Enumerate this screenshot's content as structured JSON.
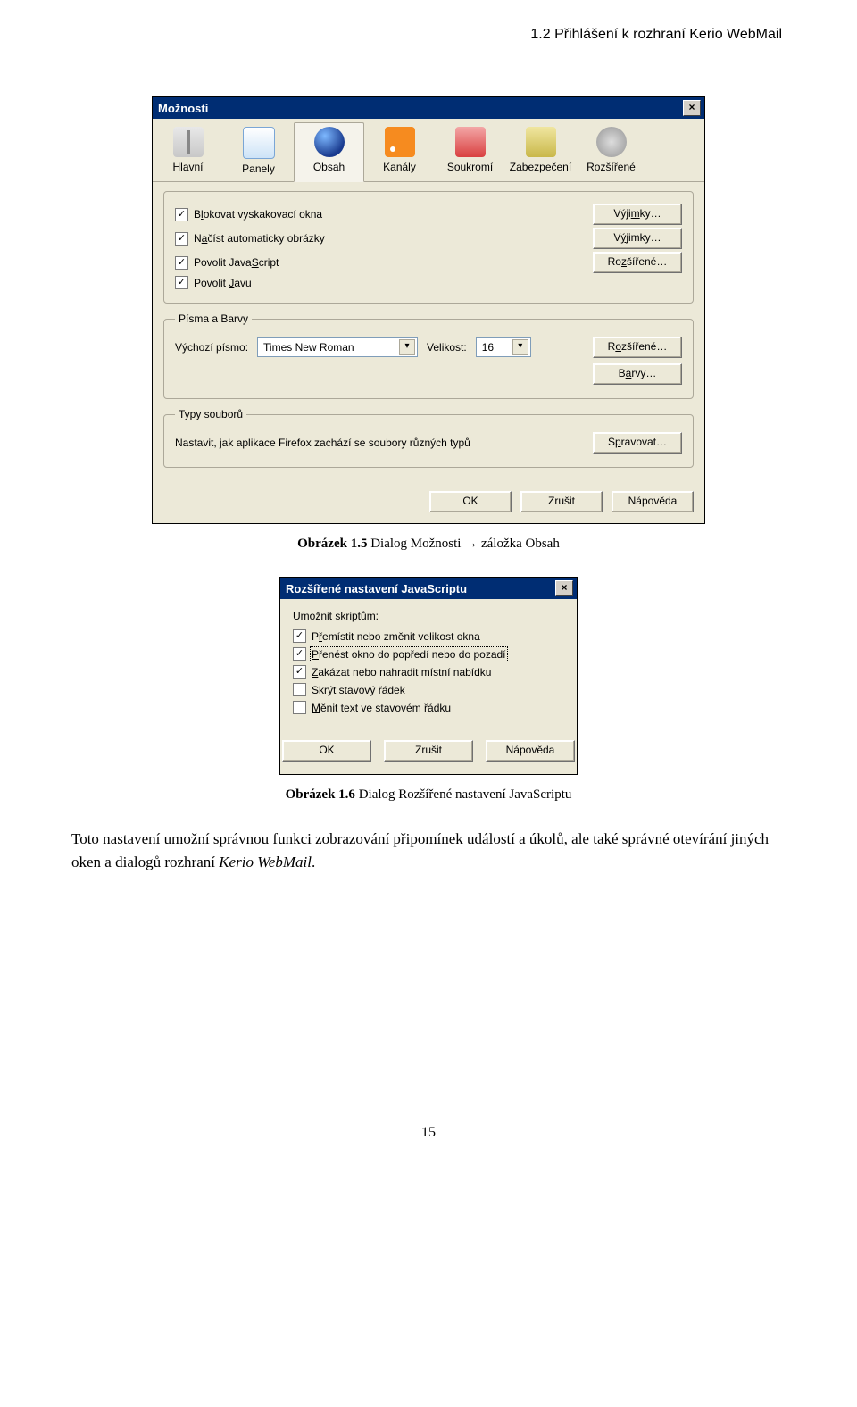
{
  "header": "1.2  Přihlášení k rozhraní Kerio WebMail",
  "dialog1": {
    "title": "Možnosti",
    "close": "×",
    "tabs": [
      {
        "label": "Hlavní"
      },
      {
        "label": "Panely"
      },
      {
        "label": "Obsah"
      },
      {
        "label": "Kanály"
      },
      {
        "label": "Soukromí"
      },
      {
        "label": "Zabezpečení"
      },
      {
        "label": "Rozšířené"
      }
    ],
    "group1": {
      "opt_block_pre": "B",
      "opt_block_u": "l",
      "opt_block_post": "okovat vyskakovací okna",
      "opt_img_pre": "N",
      "opt_img_u": "a",
      "opt_img_post": "číst automaticky obrázky",
      "opt_js_pre": "Povolit Java",
      "opt_js_u": "S",
      "opt_js_post": "cript",
      "opt_java_pre": "Povolit ",
      "opt_java_u": "J",
      "opt_java_post": "avu",
      "btn_ex1_pre": "Výji",
      "btn_ex1_u": "m",
      "btn_ex1_post": "ky…",
      "btn_ex2_pre": "V",
      "btn_ex2_u": "ý",
      "btn_ex2_post": "jimky…",
      "btn_adv_pre": "Ro",
      "btn_adv_u": "z",
      "btn_adv_post": "šířené…"
    },
    "group_fonts": {
      "legend": "Písma a Barvy",
      "label_font": "Výchozí písmo:",
      "font_value": "Times New Roman",
      "label_size": "Velikost:",
      "size_value": "16",
      "btn_adv_pre": "R",
      "btn_adv_u": "o",
      "btn_adv_post": "zšířené…",
      "btn_col_pre": "B",
      "btn_col_u": "a",
      "btn_col_post": "rvy…"
    },
    "group_files": {
      "legend": "Typy souborů",
      "text": "Nastavit, jak aplikace Firefox zachází se soubory různých typů",
      "btn_pre": "S",
      "btn_u": "p",
      "btn_post": "ravovat…"
    },
    "buttons": {
      "ok": "OK",
      "cancel": "Zrušit",
      "help": "Nápověda"
    }
  },
  "caption1": {
    "bold": "Obrázek 1.5",
    "rest": "   Dialog Možnosti → záložka Obsah"
  },
  "dialog2": {
    "title": "Rozšířené nastavení JavaScriptu",
    "close": "×",
    "heading": "Umožnit skriptům:",
    "opts": {
      "o1_pre": "P",
      "o1_u": "ř",
      "o1_post": "emístit nebo změnit velikost okna",
      "o2_pre": "",
      "o2_u": "P",
      "o2_post": "řenést okno do popředí nebo do pozadí",
      "o3_pre": "",
      "o3_u": "Z",
      "o3_post": "akázat nebo nahradit místní nabídku",
      "o4_pre": "",
      "o4_u": "S",
      "o4_post": "krýt stavový řádek",
      "o5_pre": "",
      "o5_u": "M",
      "o5_post": "ěnit text ve stavovém řádku"
    },
    "buttons": {
      "ok": "OK",
      "cancel": "Zrušit",
      "help": "Nápověda"
    }
  },
  "caption2": {
    "bold": "Obrázek 1.6",
    "rest": "   Dialog Rozšířené nastavení JavaScriptu"
  },
  "paragraph_pre": "Toto nastavení umožní správnou funkci zobrazování připomínek událostí a úkolů, ale také správné otevírání jiných oken a dialogů rozhraní ",
  "paragraph_it": "Kerio WebMail",
  "paragraph_post": ".",
  "page_num": "15",
  "glyphs": {
    "check": "✓",
    "dropdown": "▾"
  }
}
